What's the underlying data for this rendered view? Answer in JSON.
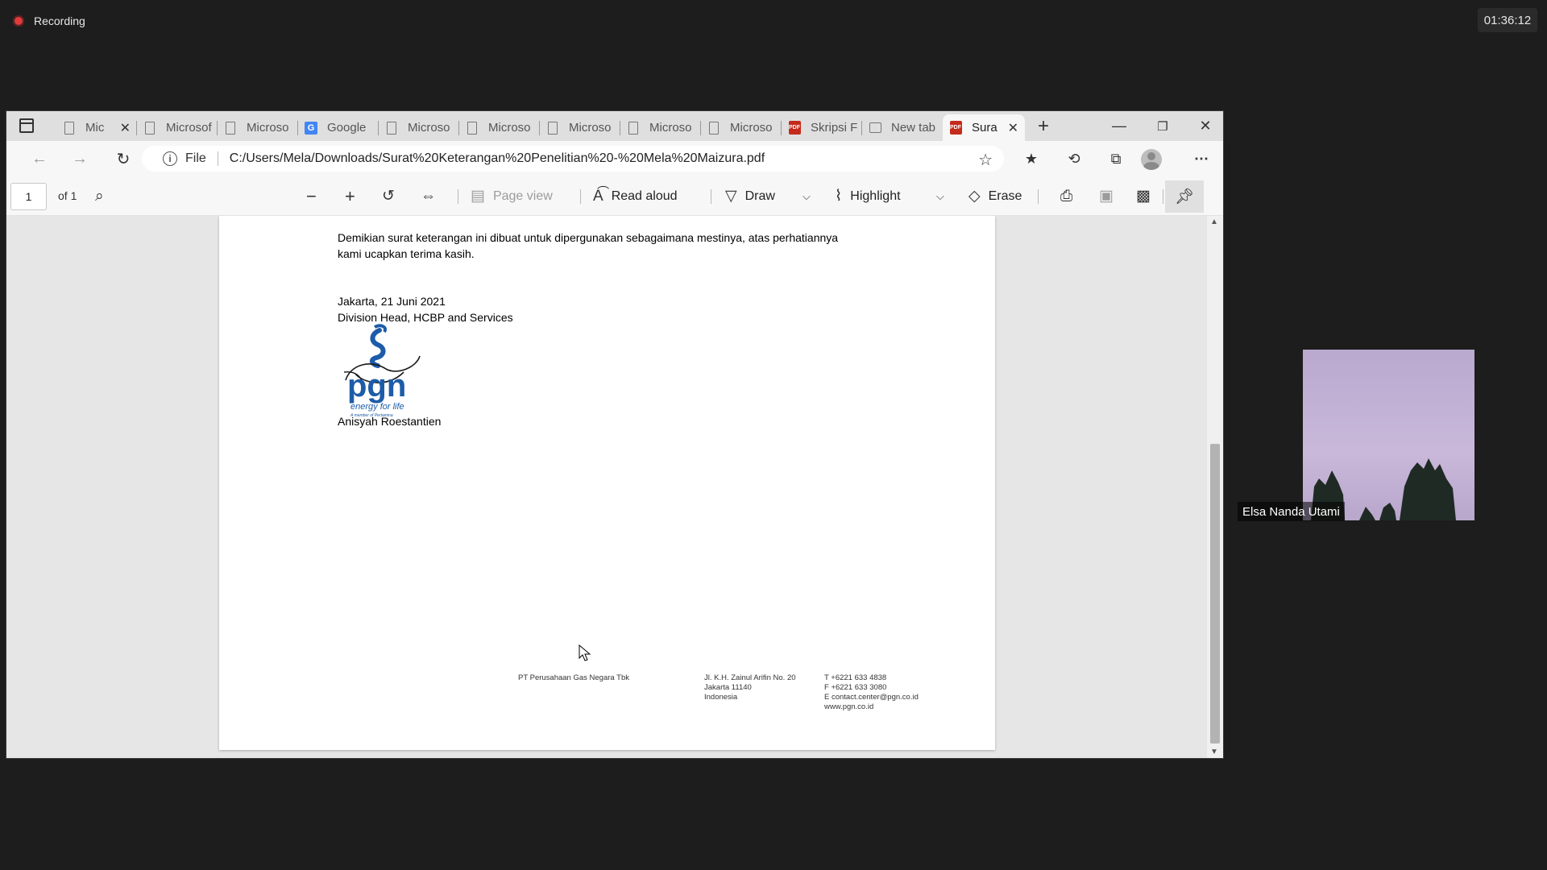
{
  "recording": {
    "label": "Recording",
    "timer": "01:36:12"
  },
  "browser": {
    "tabs": [
      {
        "title": "Mic",
        "icon": "page-icon"
      },
      {
        "title": "Microsof",
        "icon": "page-icon"
      },
      {
        "title": "Microso",
        "icon": "page-icon"
      },
      {
        "title": "Google",
        "icon": "google-translate-icon"
      },
      {
        "title": "Microso",
        "icon": "page-icon"
      },
      {
        "title": "Microso",
        "icon": "page-icon"
      },
      {
        "title": "Microso",
        "icon": "page-icon"
      },
      {
        "title": "Microso",
        "icon": "page-icon"
      },
      {
        "title": "Microso",
        "icon": "page-icon"
      },
      {
        "title": "Skripsi F",
        "icon": "pdf-icon"
      },
      {
        "title": "New tab",
        "icon": "new-tab-icon"
      },
      {
        "title": "Sura",
        "icon": "pdf-icon",
        "active": true
      }
    ],
    "address": {
      "scheme": "File",
      "url": "C:/Users/Mela/Downloads/Surat%20Keterangan%20Penelitian%20-%20Mela%20Maizura.pdf"
    }
  },
  "pdf_toolbar": {
    "page_number": "1",
    "page_count": "of 1",
    "page_view": "Page view",
    "read_aloud": "Read aloud",
    "draw": "Draw",
    "highlight": "Highlight",
    "erase": "Erase"
  },
  "document": {
    "closing_line1": "Demikian surat keterangan ini dibuat untuk dipergunakan sebagaimana mestinya, atas perhatiannya",
    "closing_line2": "kami ucapkan terima kasih.",
    "place_date": "Jakarta, 21 Juni 2021",
    "position": "Division Head, HCBP and Services",
    "logo_text": "pgn",
    "logo_tagline": "energy for life",
    "logo_subtag": "A member of Pertamina",
    "signatory": "Anisyah Roestantien",
    "footer": {
      "company": "PT Perusahaan Gas Negara Tbk",
      "address": [
        "Jl. K.H. Zainul Arifin No. 20",
        "Jakarta 11140",
        "Indonesia"
      ],
      "contacts": [
        "T  +6221 633 4838",
        "F  +6221 633 3080",
        "E  contact.center@pgn.co.id",
        "www.pgn.co.id"
      ]
    }
  },
  "participant": {
    "name": "Elsa Nanda Utami"
  },
  "colors": {
    "brand_blue": "#1d5ca8",
    "pdf_red": "#c42b1c",
    "recording_red": "#e03b3b"
  }
}
